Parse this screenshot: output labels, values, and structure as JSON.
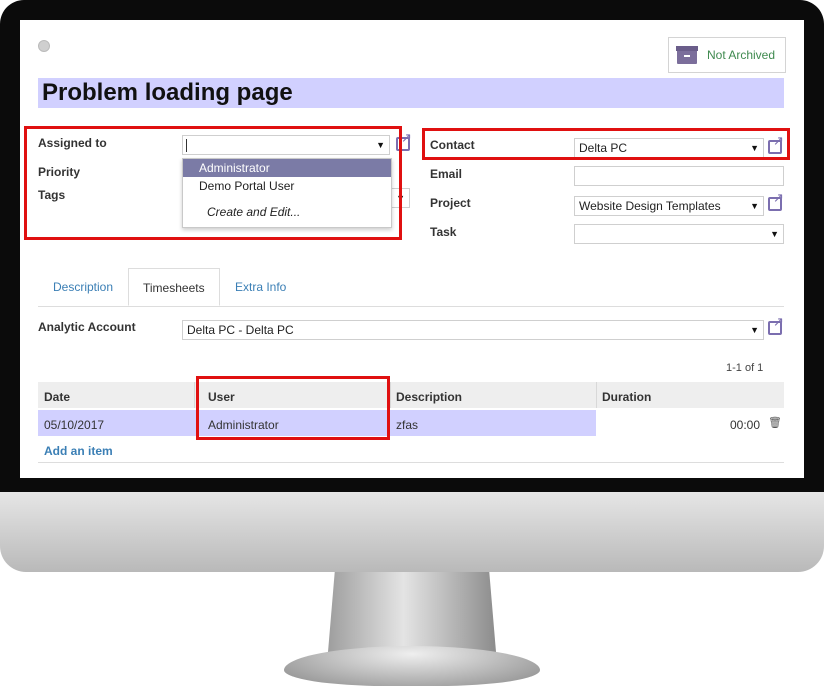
{
  "header": {
    "archive_label": "Not Archived",
    "title": "Problem loading page"
  },
  "form": {
    "assigned_to_label": "Assigned to",
    "assigned_to_value": "",
    "priority_label": "Priority",
    "tags_label": "Tags",
    "contact_label": "Contact",
    "contact_value": "Delta PC",
    "email_label": "Email",
    "email_value": "",
    "project_label": "Project",
    "project_value": "Website Design Templates",
    "task_label": "Task",
    "task_value": ""
  },
  "assignee_dropdown": {
    "options": [
      "Administrator",
      "Demo Portal User"
    ],
    "create_label": "Create and Edit..."
  },
  "tabs": [
    "Description",
    "Timesheets",
    "Extra Info"
  ],
  "analytic": {
    "label": "Analytic Account",
    "value": "Delta PC - Delta PC"
  },
  "pager": "1-1 of 1",
  "table": {
    "columns": [
      "Date",
      "User",
      "Description",
      "Duration"
    ],
    "rows": [
      {
        "date": "05/10/2017",
        "user": "Administrator",
        "description": "zfas",
        "duration": "00:00"
      }
    ],
    "add_item_label": "Add an item"
  },
  "colors": {
    "accent": "#7b6eaf",
    "highlight": "#d1d0ff",
    "annotation_red": "#e01010"
  }
}
